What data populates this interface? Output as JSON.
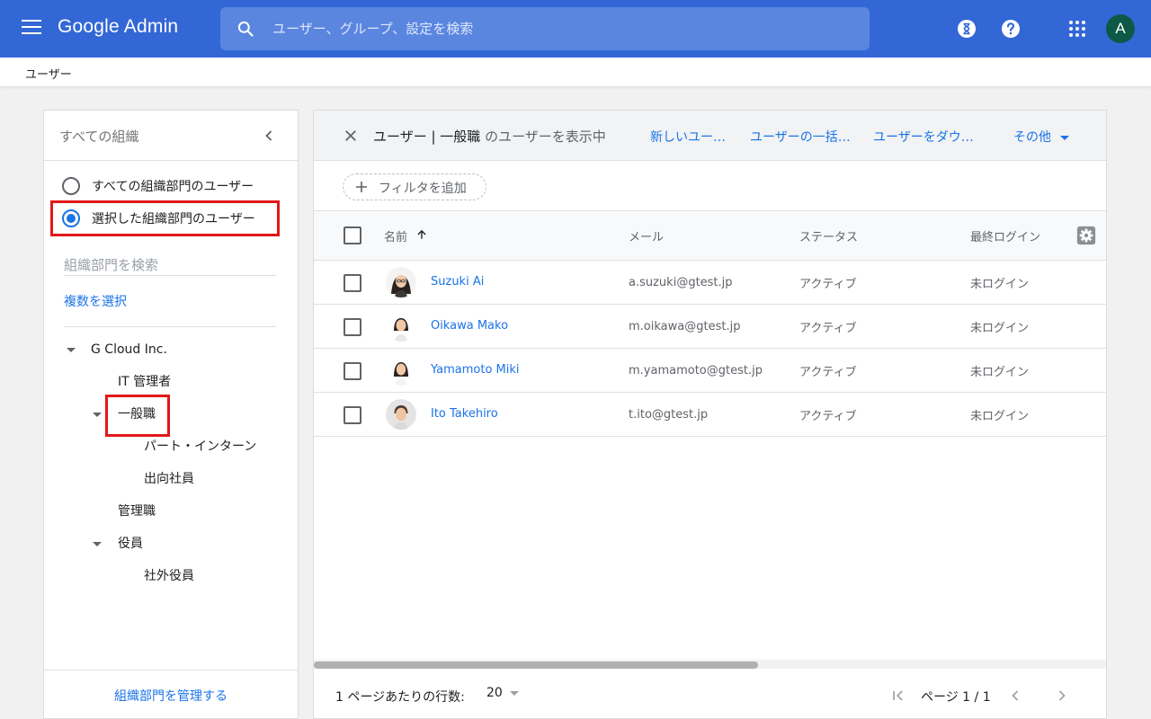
{
  "app": {
    "logo": "Google Admin"
  },
  "search": {
    "placeholder": "ユーザー、グループ、設定を検索"
  },
  "user": {
    "avatar_letter": "A"
  },
  "breadcrumb": {
    "current": "ユーザー"
  },
  "sidebar": {
    "title": "すべての組織",
    "radio_all": "すべての組織部門のユーザー",
    "radio_selected": "選択した組織部門のユーザー",
    "search_placeholder": "組織部門を検索",
    "multi_select": "複数を選択",
    "tree": {
      "root": "G Cloud Inc.",
      "it": "IT 管理者",
      "general": "一般職",
      "part": "パート・インターン",
      "seconded": "出向社員",
      "manager": "管理職",
      "officer": "役員",
      "outside_officer": "社外役員"
    },
    "manage_link": "組織部門を管理する"
  },
  "main": {
    "title_prefix": "ユーザー | 一般職",
    "title_suffix": " のユーザーを表示中",
    "actions": {
      "new_user": "新しいユー…",
      "bulk": "ユーザーの一括…",
      "download": "ユーザーをダウ…",
      "more": "その他"
    },
    "filter_label": "フィルタを追加",
    "columns": {
      "name": "名前",
      "email": "メール",
      "status": "ステータス",
      "last_login": "最終ログイン"
    },
    "rows": [
      {
        "name": "Suzuki Ai",
        "email": "a.suzuki@gtest.jp",
        "status": "アクティブ",
        "last_login": "未ログイン"
      },
      {
        "name": "Oikawa Mako",
        "email": "m.oikawa@gtest.jp",
        "status": "アクティブ",
        "last_login": "未ログイン"
      },
      {
        "name": "Yamamoto Miki",
        "email": "m.yamamoto@gtest.jp",
        "status": "アクティブ",
        "last_login": "未ログイン"
      },
      {
        "name": "Ito Takehiro",
        "email": "t.ito@gtest.jp",
        "status": "アクティブ",
        "last_login": "未ログイン"
      }
    ],
    "footer": {
      "rows_per_page_label": "1 ページあたりの行数:",
      "rows_per_page": "20",
      "page": "ページ 1 / 1"
    }
  },
  "colors": {
    "header_blue": "#3367d6",
    "link_blue": "#1a73e8",
    "highlight_red": "#e21818",
    "avatar_green": "#0d5846"
  },
  "icons": [
    "menu-icon",
    "search-icon",
    "hourglass-icon",
    "help-icon",
    "apps-icon",
    "chevron-left-icon",
    "close-icon",
    "plus-icon",
    "arrow-up-icon",
    "settings-icon",
    "first-page-icon",
    "chevron-right-icon"
  ]
}
